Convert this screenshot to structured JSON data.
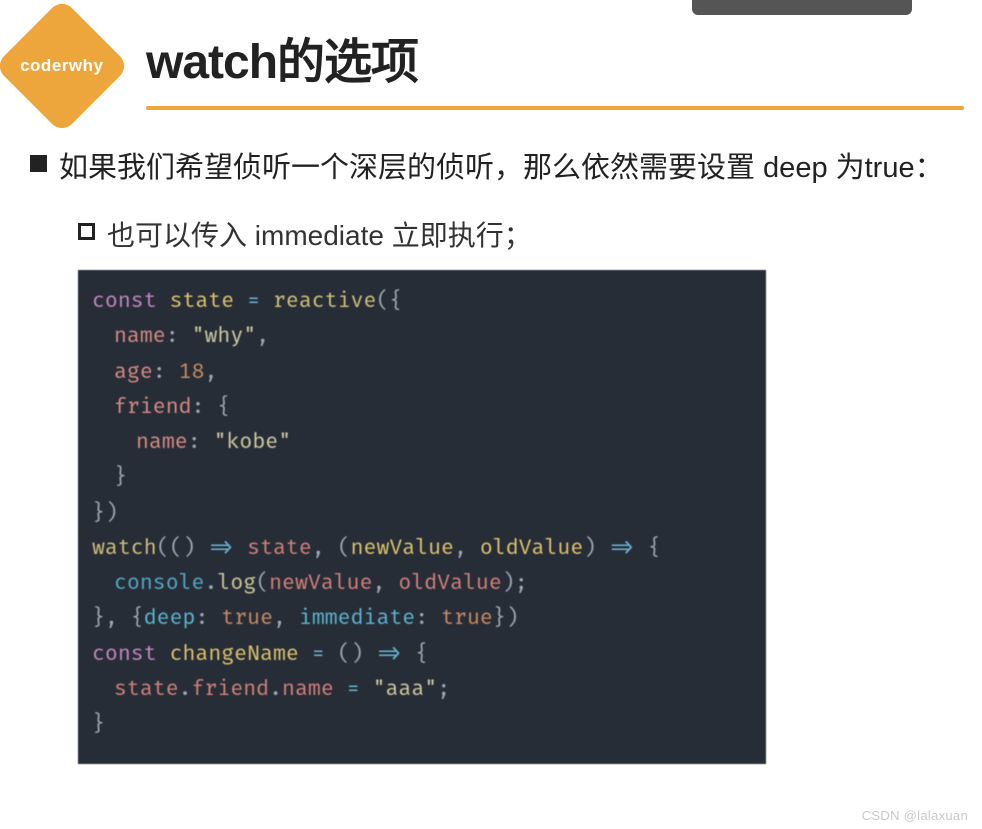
{
  "logo": {
    "text": "coderwhy"
  },
  "title": "watch的选项",
  "bullets": {
    "level1": "如果我们希望侦听一个深层的侦听，那么依然需要设置 deep 为true：",
    "level2": "也可以传入 immediate 立即执行；"
  },
  "code": {
    "lines": [
      {
        "cls": "",
        "t": [
          [
            "s-kw",
            "const"
          ],
          [
            "",
            " "
          ],
          [
            "s-var",
            "state"
          ],
          [
            "",
            " "
          ],
          [
            "s-op",
            "="
          ],
          [
            "",
            " "
          ],
          [
            "s-fn",
            "reactive"
          ],
          [
            "s-pun",
            "("
          ],
          [
            "s-pun",
            "{"
          ]
        ]
      },
      {
        "cls": "indent1",
        "t": [
          [
            "s-propred",
            "name"
          ],
          [
            "s-pun",
            ":"
          ],
          [
            "",
            " "
          ],
          [
            "s-str",
            "\"why\""
          ],
          [
            "s-pun",
            ","
          ]
        ]
      },
      {
        "cls": "indent1",
        "t": [
          [
            "s-propred",
            "age"
          ],
          [
            "s-pun",
            ":"
          ],
          [
            "",
            " "
          ],
          [
            "s-num",
            "18"
          ],
          [
            "s-pun",
            ","
          ]
        ]
      },
      {
        "cls": "indent1",
        "t": [
          [
            "s-propred",
            "friend"
          ],
          [
            "s-pun",
            ":"
          ],
          [
            "",
            " "
          ],
          [
            "s-pun",
            "{"
          ]
        ]
      },
      {
        "cls": "indent2",
        "t": [
          [
            "s-propred",
            "name"
          ],
          [
            "s-pun",
            ":"
          ],
          [
            "",
            " "
          ],
          [
            "s-str",
            "\"kobe\""
          ]
        ]
      },
      {
        "cls": "indent1",
        "t": [
          [
            "s-pun",
            "}"
          ]
        ]
      },
      {
        "cls": "",
        "t": [
          [
            "s-pun",
            "}"
          ],
          [
            "s-pun",
            ")"
          ]
        ]
      },
      {
        "cls": "",
        "t": [
          [
            "",
            ""
          ]
        ]
      },
      {
        "cls": "",
        "t": [
          [
            "s-fn",
            "watch"
          ],
          [
            "s-pun",
            "("
          ],
          [
            "s-pun",
            "()"
          ],
          [
            "",
            " "
          ],
          [
            "s-op",
            "=>"
          ],
          [
            "",
            " "
          ],
          [
            "s-red",
            "state"
          ],
          [
            "s-pun",
            ","
          ],
          [
            "",
            " "
          ],
          [
            "s-pun",
            "("
          ],
          [
            "s-arg",
            "newValue"
          ],
          [
            "s-pun",
            ","
          ],
          [
            "",
            " "
          ],
          [
            "s-arg",
            "oldValue"
          ],
          [
            "s-pun",
            ")"
          ],
          [
            "",
            " "
          ],
          [
            "s-op",
            "=>"
          ],
          [
            "",
            " "
          ],
          [
            "s-pun",
            "{"
          ]
        ]
      },
      {
        "cls": "indent1",
        "t": [
          [
            "s-cons",
            "console"
          ],
          [
            "s-pun",
            "."
          ],
          [
            "s-meth",
            "log"
          ],
          [
            "s-pun",
            "("
          ],
          [
            "s-red",
            "newValue"
          ],
          [
            "s-pun",
            ","
          ],
          [
            "",
            " "
          ],
          [
            "s-red",
            "oldValue"
          ],
          [
            "s-pun",
            ")"
          ],
          [
            "s-pun",
            ";"
          ]
        ]
      },
      {
        "cls": "",
        "t": [
          [
            "s-pun",
            "}"
          ],
          [
            "s-pun",
            ","
          ],
          [
            "",
            " "
          ],
          [
            "s-pun",
            "{"
          ],
          [
            "s-prop",
            "deep"
          ],
          [
            "s-pun",
            ":"
          ],
          [
            "",
            " "
          ],
          [
            "s-num",
            "true"
          ],
          [
            "s-pun",
            ","
          ],
          [
            "",
            " "
          ],
          [
            "s-prop",
            "immediate"
          ],
          [
            "s-pun",
            ":"
          ],
          [
            "",
            " "
          ],
          [
            "s-num",
            "true"
          ],
          [
            "s-pun",
            "}"
          ],
          [
            "s-pun",
            ")"
          ]
        ]
      },
      {
        "cls": "",
        "t": [
          [
            "",
            ""
          ]
        ]
      },
      {
        "cls": "",
        "t": [
          [
            "s-kw",
            "const"
          ],
          [
            "",
            " "
          ],
          [
            "s-var",
            "changeName"
          ],
          [
            "",
            " "
          ],
          [
            "s-op",
            "="
          ],
          [
            "",
            " "
          ],
          [
            "s-pun",
            "()"
          ],
          [
            "",
            " "
          ],
          [
            "s-op",
            "=>"
          ],
          [
            "",
            " "
          ],
          [
            "s-pun",
            "{"
          ]
        ]
      },
      {
        "cls": "indent1",
        "t": [
          [
            "s-red",
            "state"
          ],
          [
            "s-pun",
            "."
          ],
          [
            "s-red",
            "friend"
          ],
          [
            "s-pun",
            "."
          ],
          [
            "s-red",
            "name"
          ],
          [
            "",
            " "
          ],
          [
            "s-op",
            "="
          ],
          [
            "",
            " "
          ],
          [
            "s-str",
            "\"aaa\""
          ],
          [
            "s-pun",
            ";"
          ]
        ]
      },
      {
        "cls": "",
        "t": [
          [
            "s-pun",
            "}"
          ]
        ]
      }
    ]
  },
  "watermark": "CSDN @lalaxuan"
}
